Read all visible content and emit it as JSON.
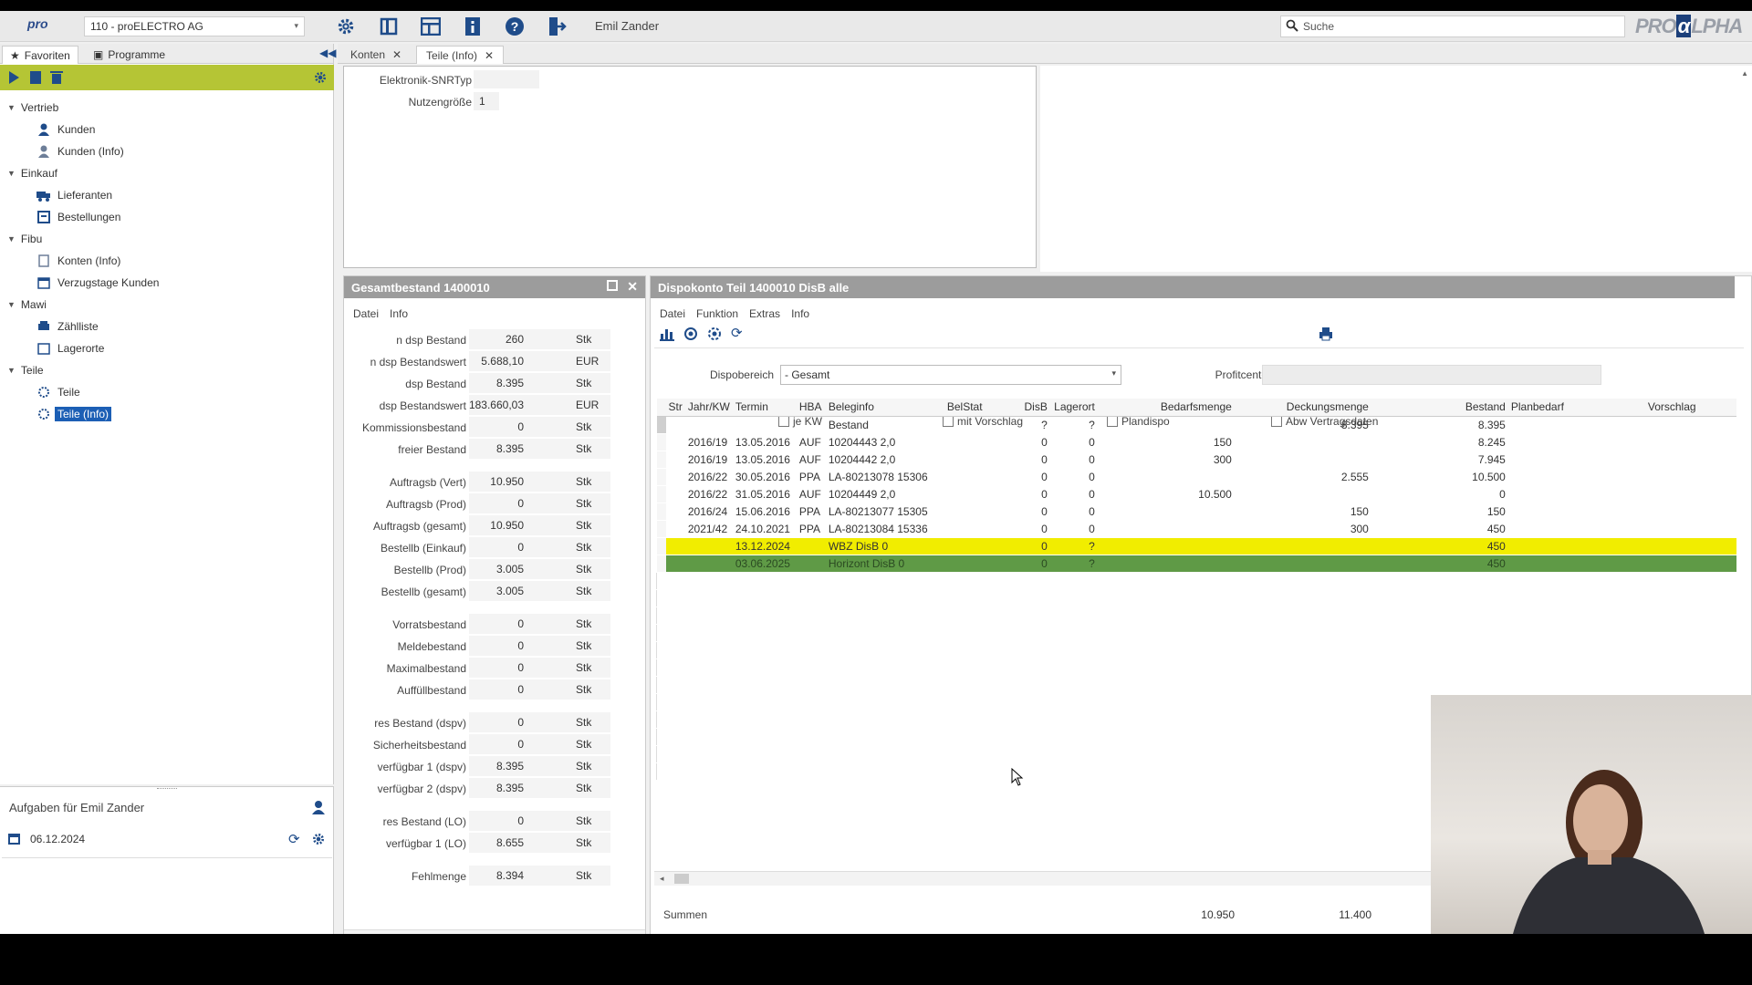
{
  "header": {
    "logo": "pro",
    "company_select": "110 - proELECTRO AG",
    "user": "Emil Zander",
    "search_placeholder": "Suche",
    "brand_pre": "PRO",
    "brand_alpha": "α",
    "brand_post": "LPHA"
  },
  "left": {
    "tabs": [
      "Favoriten",
      "Programme"
    ],
    "tree": [
      {
        "label": "Vertrieb",
        "children": [
          {
            "label": "Kunden",
            "icon": "person-icon"
          },
          {
            "label": "Kunden (Info)",
            "icon": "person-info-icon"
          }
        ]
      },
      {
        "label": "Einkauf",
        "children": [
          {
            "label": "Lieferanten",
            "icon": "truck-icon"
          },
          {
            "label": "Bestellungen",
            "icon": "order-icon"
          }
        ]
      },
      {
        "label": "Fibu",
        "children": [
          {
            "label": "Konten (Info)",
            "icon": "account-icon"
          },
          {
            "label": "Verzugstage Kunden",
            "icon": "calendar-table-icon"
          }
        ]
      },
      {
        "label": "Mawi",
        "children": [
          {
            "label": "Zählliste",
            "icon": "printer-list-icon"
          },
          {
            "label": "Lagerorte",
            "icon": "warehouse-icon"
          }
        ]
      },
      {
        "label": "Teile",
        "children": [
          {
            "label": "Teile",
            "icon": "parts-icon"
          },
          {
            "label": "Teile (Info)",
            "icon": "parts-info-icon",
            "selected": true
          }
        ]
      }
    ],
    "tasks_title": "Aufgaben für Emil Zander",
    "tasks_date": "06.12.2024"
  },
  "tabs": [
    {
      "label": "Konten"
    },
    {
      "label": "Teile (Info)",
      "active": true
    }
  ],
  "top_fields": [
    {
      "label": "Elektronik-SNRTyp",
      "value": ""
    },
    {
      "label": "Nutzengröße",
      "value": "1"
    }
  ],
  "gesamt": {
    "title": "Gesamtbestand 1400010",
    "menu": [
      "Datei",
      "Info"
    ],
    "rows": [
      {
        "l": "n dsp Bestand",
        "v": "260",
        "u": "Stk"
      },
      {
        "l": "n dsp Bestandswert",
        "v": "5.688,10",
        "u": "EUR"
      },
      {
        "l": "dsp Bestand",
        "v": "8.395",
        "u": "Stk"
      },
      {
        "l": "dsp Bestandswert",
        "v": "183.660,03",
        "u": "EUR"
      },
      {
        "l": "Kommissionsbestand",
        "v": "0",
        "u": "Stk"
      },
      {
        "l": "freier Bestand",
        "v": "8.395",
        "u": "Stk"
      },
      {
        "l": "Auftragsb (Vert)",
        "v": "10.950",
        "u": "Stk",
        "gap": true
      },
      {
        "l": "Auftragsb (Prod)",
        "v": "0",
        "u": "Stk"
      },
      {
        "l": "Auftragsb (gesamt)",
        "v": "10.950",
        "u": "Stk"
      },
      {
        "l": "Bestellb (Einkauf)",
        "v": "0",
        "u": "Stk"
      },
      {
        "l": "Bestellb (Prod)",
        "v": "3.005",
        "u": "Stk"
      },
      {
        "l": "Bestellb (gesamt)",
        "v": "3.005",
        "u": "Stk"
      },
      {
        "l": "Vorratsbestand",
        "v": "0",
        "u": "Stk",
        "gap": true
      },
      {
        "l": "Meldebestand",
        "v": "0",
        "u": "Stk"
      },
      {
        "l": "Maximalbestand",
        "v": "0",
        "u": "Stk"
      },
      {
        "l": "Auffüllbestand",
        "v": "0",
        "u": "Stk"
      },
      {
        "l": "res Bestand (dspv)",
        "v": "0",
        "u": "Stk",
        "gap": true
      },
      {
        "l": "Sicherheitsbestand",
        "v": "0",
        "u": "Stk"
      },
      {
        "l": "verfügbar 1 (dspv)",
        "v": "8.395",
        "u": "Stk"
      },
      {
        "l": "verfügbar 2 (dspv)",
        "v": "8.395",
        "u": "Stk"
      },
      {
        "l": "res Bestand (LO)",
        "v": "0",
        "u": "Stk",
        "gap": true
      },
      {
        "l": "verfügbar 1 (LO)",
        "v": "8.655",
        "u": "Stk"
      },
      {
        "l": "Fehlmenge",
        "v": "8.394",
        "u": "Stk",
        "gap": true
      }
    ]
  },
  "dispo": {
    "title": "Dispokonto  Teil 1400010 DisB alle",
    "menu": [
      "Datei",
      "Funktion",
      "Extras",
      "Info"
    ],
    "dispobereich_label": "Dispobereich",
    "dispobereich_value": "- Gesamt",
    "profitcenter_label": "Profitcenter",
    "checkboxes": [
      "je KW",
      "mit Vorschlag",
      "Plandispo",
      "Abw Vertragsdaten"
    ],
    "columns": [
      "Str",
      "Jahr/KW",
      "Termin",
      "HBA",
      "Beleginfo",
      "BelStat",
      "DisB",
      "Lagerort",
      "Bedarfsmenge",
      "Deckungsmenge",
      "Bestand",
      "Planbedarf",
      "Vorschlag"
    ],
    "rows": [
      {
        "str": "",
        "kw": "",
        "termin": "",
        "hba": "",
        "info": "Bestand",
        "belstat": "",
        "disb": "?",
        "lager": "?",
        "bedarf": "",
        "deckung": "8.395",
        "bestand": "8.395",
        "plan": "",
        "vorschlag": ""
      },
      {
        "str": "",
        "kw": "2016/19",
        "termin": "13.05.2016",
        "hba": "AUF",
        "info": "10204443  2,0",
        "belstat": "",
        "disb": "0",
        "lager": "0",
        "bedarf": "150",
        "deckung": "",
        "bestand": "8.245",
        "plan": "",
        "vorschlag": ""
      },
      {
        "str": "",
        "kw": "2016/19",
        "termin": "13.05.2016",
        "hba": "AUF",
        "info": "10204442  2,0",
        "belstat": "",
        "disb": "0",
        "lager": "0",
        "bedarf": "300",
        "deckung": "",
        "bestand": "7.945",
        "plan": "",
        "vorschlag": ""
      },
      {
        "str": "",
        "kw": "2016/22",
        "termin": "30.05.2016",
        "hba": "PPA",
        "info": "LA-80213078 15306",
        "belstat": "",
        "disb": "0",
        "lager": "0",
        "bedarf": "",
        "deckung": "2.555",
        "bestand": "10.500",
        "plan": "",
        "vorschlag": ""
      },
      {
        "str": "",
        "kw": "2016/22",
        "termin": "31.05.2016",
        "hba": "AUF",
        "info": "10204449  2,0",
        "belstat": "",
        "disb": "0",
        "lager": "0",
        "bedarf": "10.500",
        "deckung": "",
        "bestand": "0",
        "plan": "",
        "vorschlag": ""
      },
      {
        "str": "",
        "kw": "2016/24",
        "termin": "15.06.2016",
        "hba": "PPA",
        "info": "LA-80213077 15305",
        "belstat": "",
        "disb": "0",
        "lager": "0",
        "bedarf": "",
        "deckung": "150",
        "bestand": "150",
        "plan": "",
        "vorschlag": ""
      },
      {
        "str": "",
        "kw": "2021/42",
        "termin": "24.10.2021",
        "hba": "PPA",
        "info": "LA-80213084 15336",
        "belstat": "",
        "disb": "0",
        "lager": "0",
        "bedarf": "",
        "deckung": "300",
        "bestand": "450",
        "plan": "",
        "vorschlag": ""
      },
      {
        "str": "",
        "kw": "",
        "termin": "13.12.2024",
        "hba": "",
        "info": "WBZ DisB 0",
        "belstat": "",
        "disb": "0",
        "lager": "?",
        "bedarf": "",
        "deckung": "",
        "bestand": "450",
        "plan": "",
        "vorschlag": "",
        "hl": "y"
      },
      {
        "str": "",
        "kw": "",
        "termin": "03.06.2025",
        "hba": "",
        "info": "Horizont DisB 0",
        "belstat": "",
        "disb": "0",
        "lager": "?",
        "bedarf": "",
        "deckung": "",
        "bestand": "450",
        "plan": "",
        "vorschlag": "",
        "hl": "g"
      }
    ],
    "summen_label": "Summen",
    "sum_bedarf": "10.950",
    "sum_deckung": "11.400"
  }
}
